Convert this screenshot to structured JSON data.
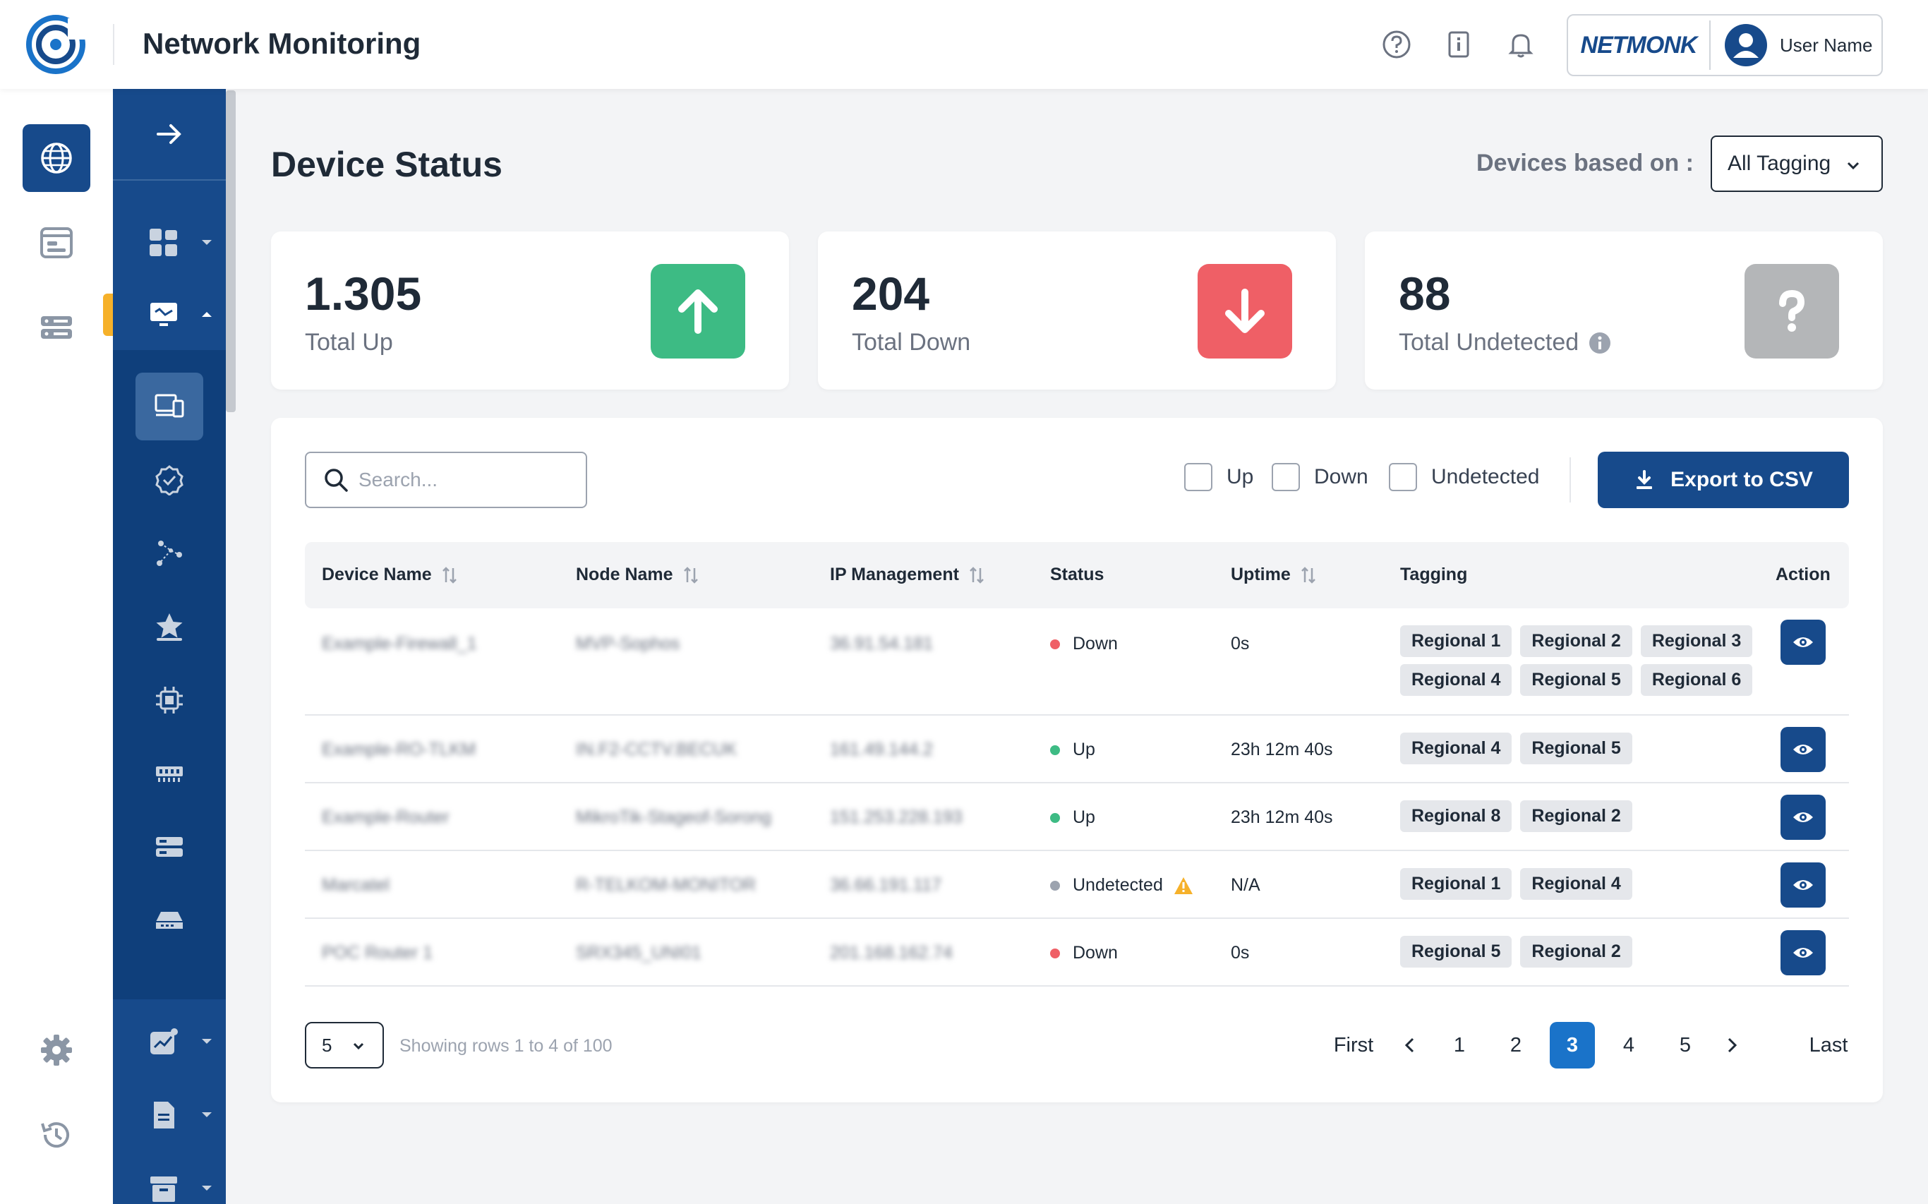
{
  "app": {
    "title": "Network Monitoring"
  },
  "header": {
    "brand": "NETMONK",
    "user_name": "User Name"
  },
  "page": {
    "title": "Device Status",
    "based_on_label": "Devices based on :",
    "based_on_value": "All Tagging"
  },
  "stats": [
    {
      "value": "1.305",
      "label": "Total Up",
      "color": "#3dbb84",
      "icon": "arrow-up-icon"
    },
    {
      "value": "204",
      "label": "Total Down",
      "color": "#ef5f66",
      "icon": "arrow-down-icon"
    },
    {
      "value": "88",
      "label": "Total Undetected",
      "color": "#b4b6b8",
      "icon": "question-icon"
    }
  ],
  "toolbar": {
    "search_placeholder": "Search...",
    "filter_up": "Up",
    "filter_down": "Down",
    "filter_undetected": "Undetected",
    "export_label": "Export to CSV"
  },
  "table": {
    "columns": [
      "Device Name",
      "Node Name",
      "IP Management",
      "Status",
      "Uptime",
      "Tagging",
      "Action"
    ],
    "rows": [
      {
        "device": "Example-Firewall_1",
        "node": "MVP-Sophos",
        "ip": "36.91.54.181",
        "status": "Down",
        "uptime": "0s",
        "tags": [
          "Regional 1",
          "Regional 2",
          "Regional 3",
          "Regional 4",
          "Regional 5",
          "Regional 6"
        ]
      },
      {
        "device": "Example-RO-TLKM",
        "node": "IN.F2-CCTV.BECUK",
        "ip": "161.49.144.2",
        "status": "Up",
        "uptime": "23h 12m 40s",
        "tags": [
          "Regional 4",
          "Regional 5"
        ]
      },
      {
        "device": "Example-Router",
        "node": "MikroTik-Stageof-Sorong",
        "ip": "151.253.228.193",
        "status": "Up",
        "uptime": "23h 12m 40s",
        "tags": [
          "Regional 8",
          "Regional 2"
        ]
      },
      {
        "device": "Marcatel",
        "node": "R-TELKOM-MONITOR",
        "ip": "36.66.191.117",
        "status": "Undetected",
        "uptime": "N/A",
        "tags": [
          "Regional 1",
          "Regional 4"
        ]
      },
      {
        "device": "POC Router 1",
        "node": "SRX345_UNI01",
        "ip": "201.168.162.74",
        "status": "Down",
        "uptime": "0s",
        "tags": [
          "Regional 5",
          "Regional 2"
        ]
      }
    ]
  },
  "pagination": {
    "page_size": "5",
    "showing": "Showing rows 1 to 4 of 100",
    "first": "First",
    "last": "Last",
    "pages": [
      "1",
      "2",
      "3",
      "4",
      "5"
    ],
    "current": "3"
  },
  "colors": {
    "primary": "#174a8b",
    "up": "#3dbb84",
    "down": "#ef5f66",
    "undetected": "#9ca3af",
    "warning": "#f6b12a",
    "active_page": "#1a73c9"
  }
}
